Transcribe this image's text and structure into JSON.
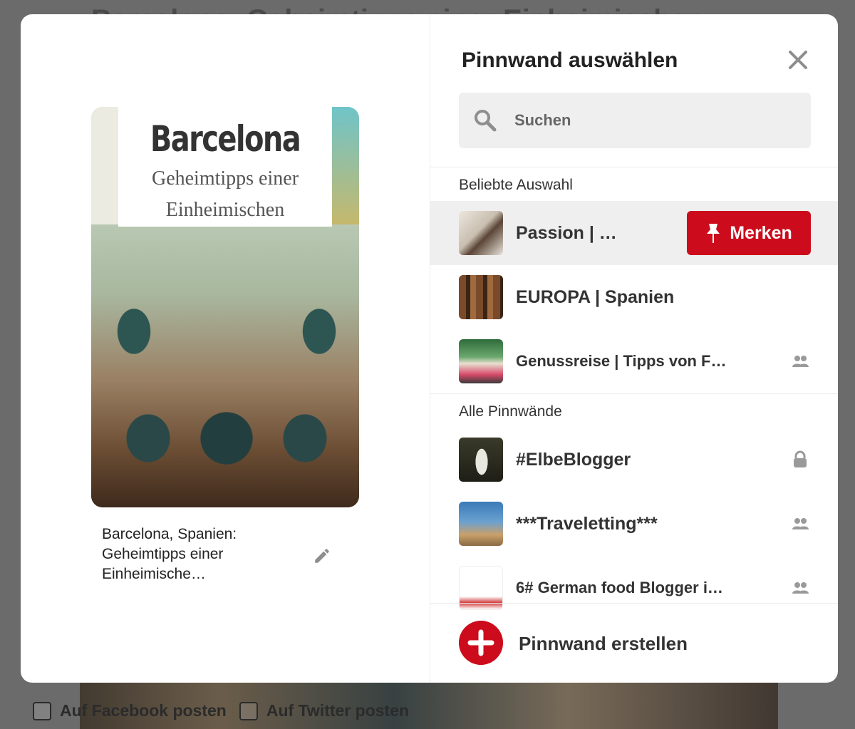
{
  "background": {
    "title": "Barcelona: Geheimtipps einer Einheimischen",
    "facebook_label": "Auf Facebook posten",
    "twitter_label": "Auf Twitter posten"
  },
  "pin": {
    "image_title": "Barcelona",
    "image_subtitle_1": "Geheimtipps einer",
    "image_subtitle_2": "Einheimischen",
    "description": "Barcelona, Spanien: Geheimtipps einer Einheimische…",
    "edit_icon": "pencil-icon"
  },
  "panel": {
    "title": "Pinnwand auswählen",
    "close_icon": "close-icon",
    "search_placeholder": "Suchen",
    "popular_label": "Beliebte Auswahl",
    "all_label": "Alle Pinnwände",
    "save_label": "Merken",
    "create_label": "Pinnwand erstellen"
  },
  "popular_boards": [
    {
      "name": "Passion | …",
      "icon": "",
      "colors": [
        "#e9e4dc",
        "#5b4536"
      ]
    },
    {
      "name": "EUROPA | Spanien",
      "icon": "",
      "colors": [
        "#7a4a2a",
        "#3a2414"
      ]
    },
    {
      "name": "Genussreise | Tipps von F…",
      "icon": "group-icon",
      "colors": [
        "#2f6b3a",
        "#d84a6a"
      ]
    }
  ],
  "all_boards": [
    {
      "name": "#ElbeBlogger",
      "icon": "lock-icon",
      "colors": [
        "#3a3a2a",
        "#e8e8e0"
      ]
    },
    {
      "name": "***Traveletting***",
      "icon": "group-icon",
      "colors": [
        "#3a7ab8",
        "#c9a06a"
      ]
    },
    {
      "name": "6# German food Blogger i…",
      "icon": "group-icon",
      "colors": [
        "#ffffff",
        "#d13a3a"
      ]
    }
  ],
  "colors": {
    "accent": "#cc0c1c",
    "overlay": "#6b6b6b"
  }
}
